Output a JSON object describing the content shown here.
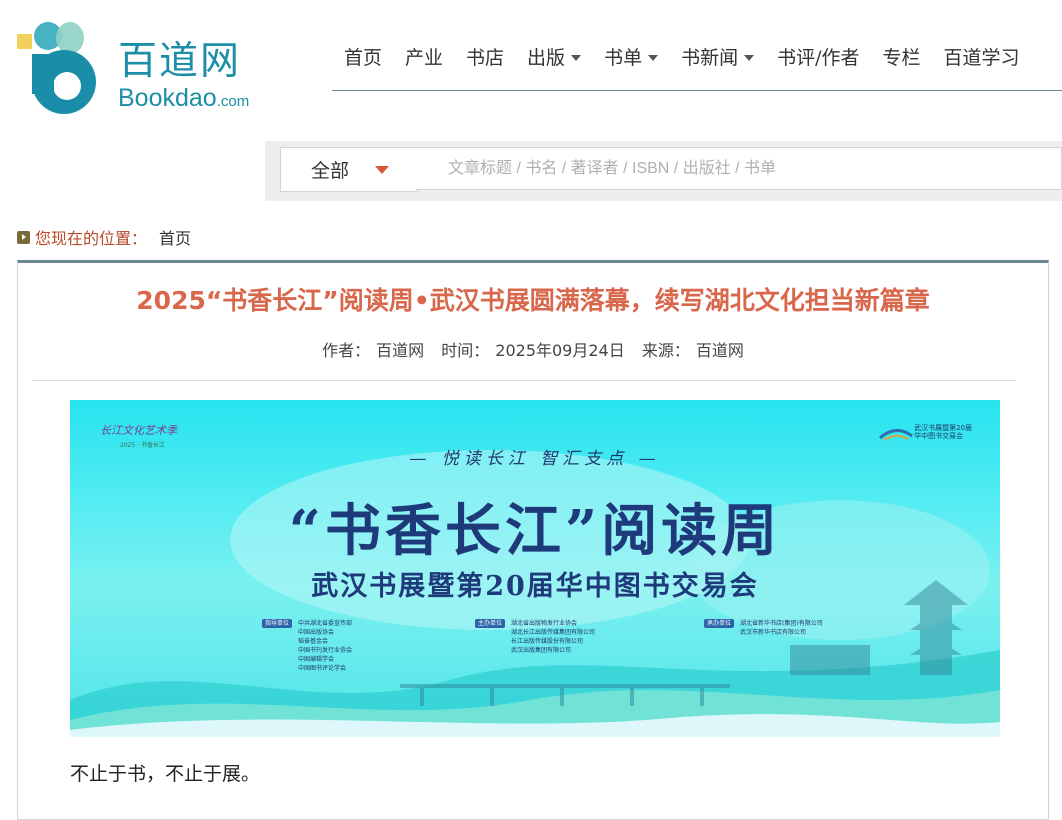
{
  "logo": {
    "cn": "百道网",
    "en_main": "Bookdao",
    "en_suffix": ".com",
    "mark_icon": "bookdao-b-icon"
  },
  "nav": {
    "items": [
      {
        "label": "首页",
        "has_dropdown": false
      },
      {
        "label": "产业",
        "has_dropdown": false
      },
      {
        "label": "书店",
        "has_dropdown": false
      },
      {
        "label": "出版",
        "has_dropdown": true
      },
      {
        "label": "书单",
        "has_dropdown": true
      },
      {
        "label": "书新闻",
        "has_dropdown": true
      },
      {
        "label": "书评/作者",
        "has_dropdown": false
      },
      {
        "label": "专栏",
        "has_dropdown": false
      },
      {
        "label": "百道学习",
        "has_dropdown": false
      }
    ]
  },
  "search": {
    "scope": "全部",
    "placeholder": "文章标题 / 书名 / 著译者 / ISBN / 出版社 / 书单"
  },
  "breadcrumb": {
    "label": "您现在的位置：",
    "home": "首页"
  },
  "article": {
    "title": "2025“书香长江”阅读周•武汉书展圆满落幕，续写湖北文化担当新篇章",
    "author_label": "作者：",
    "author": "百道网",
    "time_label": "时间：",
    "time": "2025年09月24日",
    "source_label": "来源：",
    "source": "百道网",
    "first_paragraph": "不止于书，不止于展。"
  },
  "banner": {
    "top_left_logo": "长江文化艺术季",
    "top_left_sub": "2025 · 书香长江",
    "top_right_line1": "武汉书展暨第20届",
    "top_right_line2": "华中图书交易会",
    "slogan": "— 悦读长江  智汇支点 —",
    "title": "“书香长江”阅读周",
    "subtitle": "武汉书展暨第20届华中图书交易会",
    "orgs": [
      {
        "tag": "指导单位",
        "names": [
          "中共湖北省委宣传部",
          "中国出版协会",
          "韬奋基金会",
          "中国书刊发行业协会",
          "中国编辑学会",
          "中国图书评论学会"
        ]
      },
      {
        "tag": "主办单位",
        "names": [
          "湖北省出版物发行业协会",
          "湖北长江出版传媒集团有限公司",
          "长江出版传媒股份有限公司",
          "武汉出版集团有限公司"
        ]
      },
      {
        "tag": "承办单位",
        "names": [
          "湖北省新华书店(集团)有限公司",
          "武汉市新华书店有限公司"
        ]
      }
    ]
  },
  "colors": {
    "brand_teal": "#1c8fa6",
    "title_orange": "#d9674b",
    "banner_navy": "#1e3a7a",
    "rule": "#6b8793"
  }
}
